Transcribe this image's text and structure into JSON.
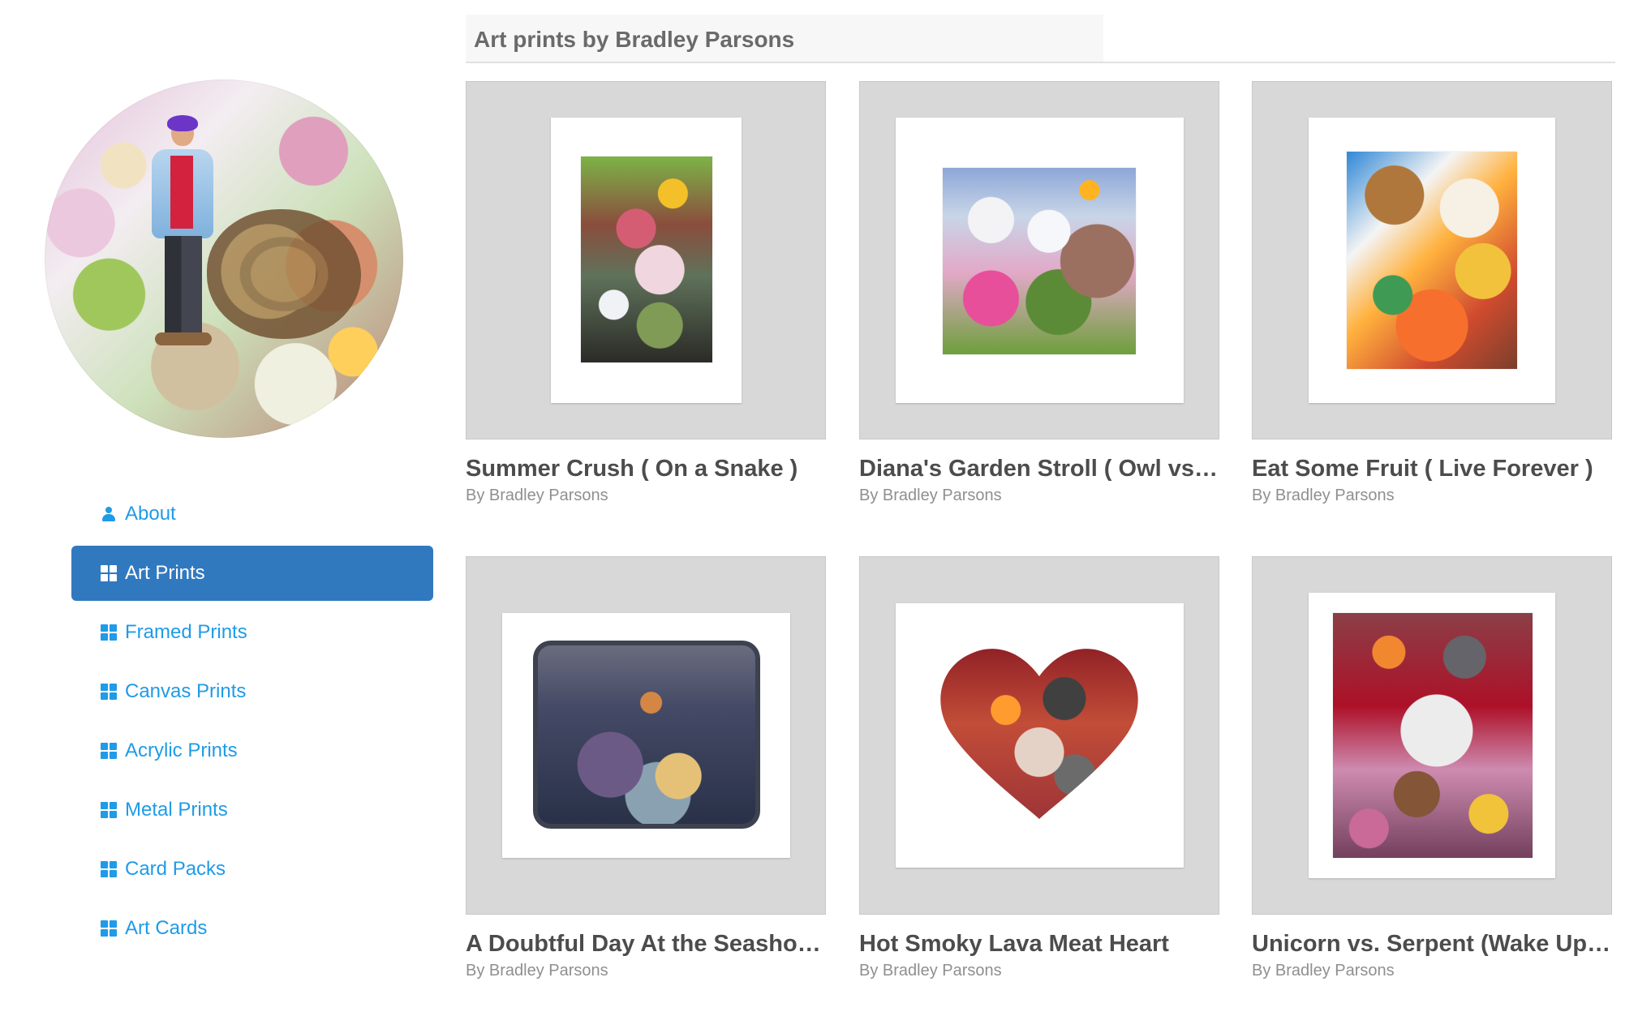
{
  "sidebar": {
    "nav": [
      {
        "label": "About",
        "icon": "person-icon",
        "active": false
      },
      {
        "label": "Art Prints",
        "icon": "grid-icon",
        "active": true
      },
      {
        "label": "Framed Prints",
        "icon": "grid-icon",
        "active": false
      },
      {
        "label": "Canvas Prints",
        "icon": "grid-icon",
        "active": false
      },
      {
        "label": "Acrylic Prints",
        "icon": "grid-icon",
        "active": false
      },
      {
        "label": "Metal Prints",
        "icon": "grid-icon",
        "active": false
      },
      {
        "label": "Card Packs",
        "icon": "grid-icon",
        "active": false
      },
      {
        "label": "Art Cards",
        "icon": "grid-icon",
        "active": false
      }
    ]
  },
  "main": {
    "title": "Art prints by Bradley Parsons",
    "cards": [
      {
        "title": "Summer Crush ( On a Snake )",
        "artist": "By Bradley Parsons"
      },
      {
        "title": "Diana's Garden Stroll ( Owl vs.…",
        "artist": "By Bradley Parsons"
      },
      {
        "title": "Eat Some Fruit ( Live Forever )",
        "artist": "By Bradley Parsons"
      },
      {
        "title": "A Doubtful Day At the Seashor…",
        "artist": "By Bradley Parsons"
      },
      {
        "title": "Hot Smoky Lava Meat Heart",
        "artist": "By Bradley Parsons"
      },
      {
        "title": "Unicorn vs. Serpent (Wake Up …",
        "artist": "By Bradley Parsons"
      }
    ]
  },
  "colors": {
    "accent_blue": "#1f9be7",
    "active_nav": "#3179bf",
    "frame_gray": "#d8d8d8",
    "title_gray": "#4c4c4c",
    "subtitle_gray": "#8f8f8f"
  }
}
